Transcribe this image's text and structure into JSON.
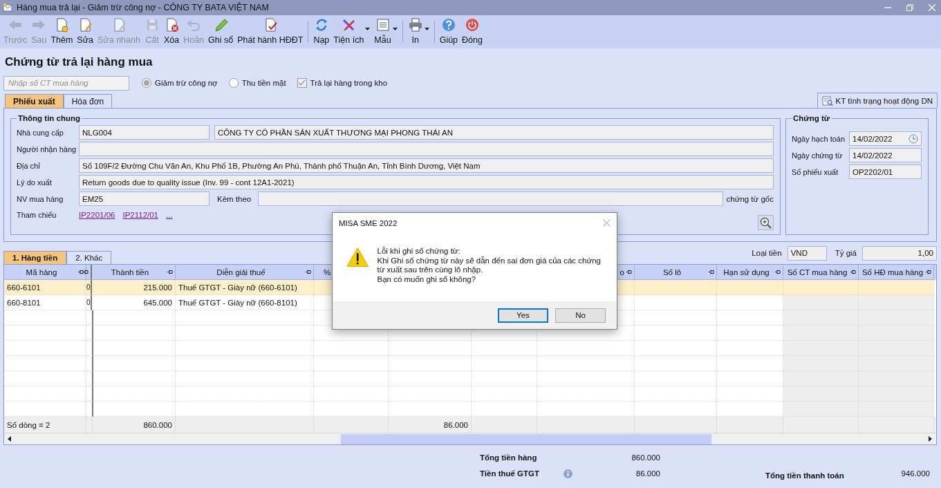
{
  "window": {
    "title": "Hàng mua trả lại - Giảm trừ công nợ - CÔNG TY BATA VIỆT NAM"
  },
  "toolbar_groups": [
    [
      {
        "label": "Trước",
        "disabled": true,
        "dropdown": false
      },
      {
        "label": "Sau",
        "disabled": true,
        "dropdown": false
      },
      {
        "label": "Thêm",
        "disabled": false,
        "dropdown": false
      },
      {
        "label": "Sửa",
        "disabled": false,
        "dropdown": false
      },
      {
        "label": "Sửa nhanh",
        "disabled": true,
        "dropdown": false
      },
      {
        "label": "Cất",
        "disabled": true,
        "dropdown": false
      },
      {
        "label": "Xóa",
        "disabled": false,
        "dropdown": false
      },
      {
        "label": "Hoãn",
        "disabled": true,
        "dropdown": false
      },
      {
        "label": "Ghi sổ",
        "disabled": false,
        "dropdown": false
      },
      {
        "label": "Phát hành HĐĐT",
        "disabled": false,
        "dropdown": false
      }
    ],
    [
      {
        "label": "Nạp",
        "disabled": false,
        "dropdown": false
      },
      {
        "label": "Tiện ích",
        "disabled": false,
        "dropdown": true
      },
      {
        "label": "Mẫu",
        "disabled": false,
        "dropdown": true
      }
    ],
    [
      {
        "label": "In",
        "disabled": false,
        "dropdown": true
      }
    ],
    [
      {
        "label": "Giúp",
        "disabled": false,
        "dropdown": false
      },
      {
        "label": "Đóng",
        "disabled": false,
        "dropdown": false
      }
    ]
  ],
  "page_title": "Chứng từ trả lại hàng mua",
  "purchase_doc_field": {
    "placeholder": "Nhập số CT mua hàng"
  },
  "options": [
    {
      "kind": "radio",
      "label": "Giảm trừ công nợ",
      "selected": true,
      "disabled": true
    },
    {
      "kind": "radio",
      "label": "Thu tiền mặt",
      "selected": false,
      "disabled": false
    },
    {
      "kind": "checkbox",
      "label": "Trả lại hàng trong kho",
      "checked": true,
      "disabled": true
    }
  ],
  "form_tabs": [
    {
      "label": "Phiếu xuất",
      "selected": true
    },
    {
      "label": "Hóa đơn",
      "selected": false
    }
  ],
  "check_button": {
    "label": "KT tình trạng hoạt động DN"
  },
  "general_info": {
    "title": "Thông tin chung",
    "supplier": {
      "label": "Nhà cung cấp",
      "code": "NLG004",
      "name": "CÔNG TY CỔ PHẦN SẢN XUẤT THƯƠNG MẠI PHONG THÁI AN"
    },
    "receiver": {
      "label": "Người nhận hàng"
    },
    "address": {
      "label": "Địa chỉ",
      "value": "Số 109F/2 Đường Chu Văn An, Khu Phố 1B, Phường An Phú, Thành phố Thuận An, Tỉnh Bình Dương, Việt Nam"
    },
    "reason": {
      "label": "Lý do xuất",
      "value": "Return goods due to quality issue (Inv. 99 - cont 12A1-2021)"
    },
    "buyer": {
      "label": "NV mua hàng",
      "value": "EM25"
    },
    "attached": {
      "label": "Kèm theo",
      "suffix": "chứng từ gốc"
    },
    "references": {
      "label": "Tham chiếu",
      "links": [
        "IP2201/06",
        "IP2112/01",
        "..."
      ]
    }
  },
  "voucher": {
    "title": "Chứng từ",
    "fields": [
      {
        "label": "Ngày hạch toán",
        "value": "14/02/2022",
        "kind": "date"
      },
      {
        "label": "Ngày chứng từ",
        "value": "14/02/2022",
        "kind": "text"
      },
      {
        "label": "Số phiếu xuất",
        "value": "OP2202/01",
        "kind": "text"
      }
    ]
  },
  "detail_tabs": [
    {
      "label": "1. Hàng tiền",
      "selected": true
    },
    {
      "label": "2. Khác",
      "selected": false
    }
  ],
  "currency": {
    "label": "Loại tiền",
    "value": "VND"
  },
  "exchange_rate": {
    "label": "Tỷ giá",
    "value": "1,00"
  },
  "table": {
    "columns": [
      {
        "label": "Mã hàng"
      },
      {},
      {
        "label": "Thành tiền"
      },
      {
        "label": "Diễn giải thuế"
      },
      {
        "label": "%"
      },
      {},
      {},
      {
        "label": "o"
      },
      {
        "label": "Số lô"
      },
      {
        "label": "Hạn sử dụng"
      },
      {
        "label": "Số CT mua hàng"
      },
      {
        "label": "Số HĐ mua hàng"
      }
    ],
    "rows": [
      {
        "selected": true,
        "cells": [
          "660-6101",
          "0",
          "215.000",
          "Thuế GTGT - Giày nữ (660-6101)"
        ]
      },
      {
        "selected": false,
        "cells": [
          "660-8101",
          "0",
          "645.000",
          "Thuế GTGT - Giày nữ (660-8101)"
        ]
      }
    ],
    "footer": {
      "count": "Số dòng = 2",
      "amount": "860.000",
      "vat": "86.000"
    }
  },
  "totals": {
    "goods": {
      "label": "Tổng tiền hàng",
      "value": "860.000"
    },
    "vat": {
      "label": "Tiền thuế GTGT",
      "value": "86.000"
    },
    "payment": {
      "label": "Tổng tiền thanh toán",
      "value": "946.000"
    }
  },
  "dialog": {
    "title": "MISA SME 2022",
    "message_lines": [
      "Lỗi khi ghi sổ chứng từ:",
      "Khi Ghi sổ chứng từ này sẽ dẫn đến sai đơn giá của các chứng từ xuất sau trên cùng lô nhập.",
      "Bạn có muốn ghi sổ không?"
    ],
    "buttons": [
      {
        "label": "Yes",
        "focused": true
      },
      {
        "label": "No",
        "focused": false
      }
    ]
  }
}
